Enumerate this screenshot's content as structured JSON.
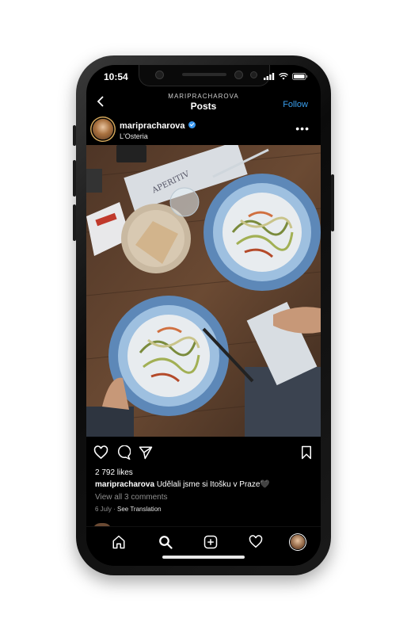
{
  "status_bar": {
    "time": "10:54"
  },
  "header": {
    "username": "MARIPRACHAROVA",
    "title": "Posts",
    "follow_label": "Follow"
  },
  "post": {
    "username": "maripracharova",
    "location": "L'Osteria",
    "likes": "2 792 likes",
    "caption_user": "maripracharova",
    "caption_text": " Udělali jsme si Itošku v Praze🖤",
    "comments_link": "View all 3 comments",
    "date": "6 July",
    "separator": " · ",
    "translation": "See Translation",
    "photo_subject": "overhead shot of two plates of zucchini pasta on a wooden table"
  },
  "icons": {
    "back": "chevron-left-icon",
    "more": "more-options-icon",
    "like": "heart-icon",
    "comment": "comment-icon",
    "share": "send-icon",
    "save": "bookmark-icon",
    "tabs": [
      "home-icon",
      "search-icon",
      "add-post-icon",
      "activity-heart-icon",
      "profile-avatar-icon"
    ]
  },
  "colors": {
    "accent": "#3897f0",
    "background": "#000000",
    "secondary_text": "#8e8e8e"
  }
}
